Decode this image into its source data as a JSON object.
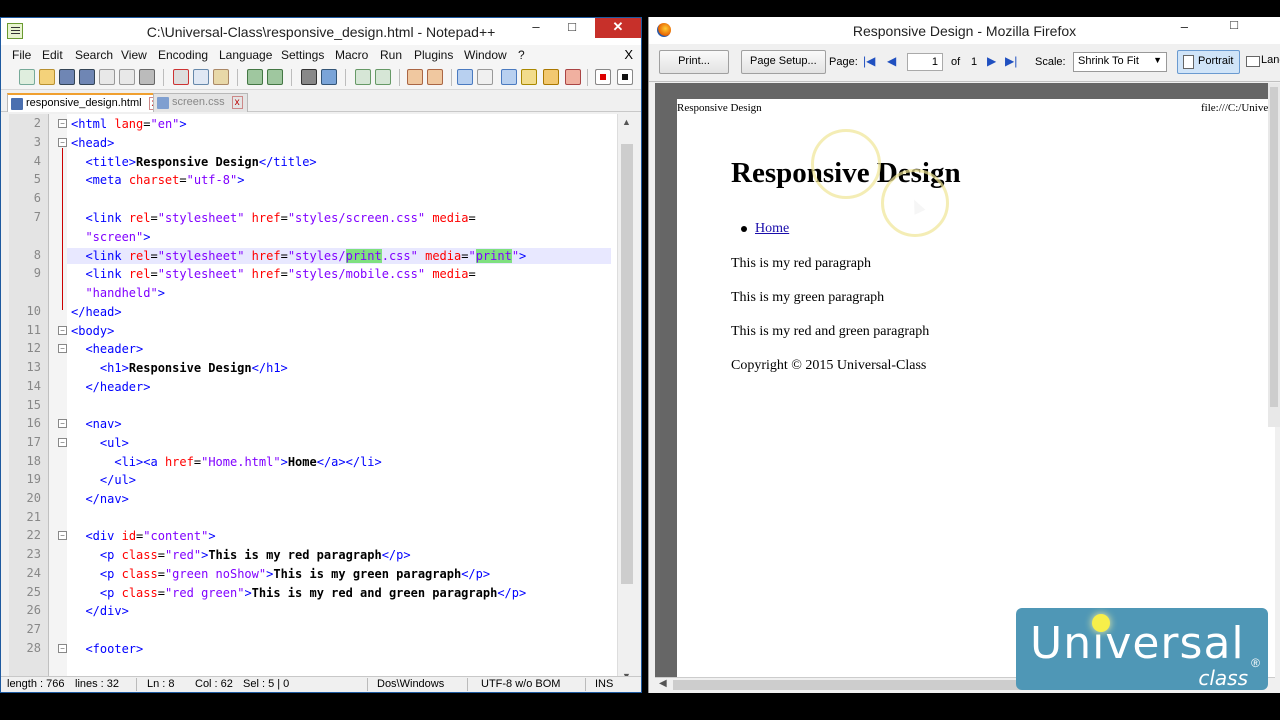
{
  "npp": {
    "title": "C:\\Universal-Class\\responsive_design.html - Notepad++",
    "window_min": "–",
    "window_max": "□",
    "window_close": "✕",
    "menu": [
      "File",
      "Edit",
      "Search",
      "View",
      "Encoding",
      "Language",
      "Settings",
      "Macro",
      "Run",
      "Plugins",
      "Window",
      "?"
    ],
    "menu_close": "X",
    "tabs": [
      {
        "label": "responsive_design.html",
        "active": true
      },
      {
        "label": "screen.css",
        "active": false
      }
    ],
    "tab_close": "x",
    "line_numbers": [
      "2",
      "3",
      "4",
      "5",
      "6",
      "7",
      "",
      "8",
      "9",
      "",
      "10",
      "11",
      "12",
      "13",
      "14",
      "15",
      "16",
      "17",
      "18",
      "19",
      "20",
      "21",
      "22",
      "23",
      "24",
      "25",
      "26",
      "27",
      "28"
    ],
    "status": {
      "length": "length : 766",
      "lines": "lines : 32",
      "ln": "Ln : 8",
      "col": "Col : 62",
      "sel": "Sel : 5 | 0",
      "eol": "Dos\\Windows",
      "encoding": "UTF-8 w/o BOM",
      "mode": "INS"
    }
  },
  "firefox": {
    "title": "Responsive Design - Mozilla Firefox",
    "window_min": "–",
    "window_max": "□",
    "print_button": "Print...",
    "page_setup_button": "Page Setup...",
    "page_label": "Page:",
    "page_value": "1",
    "of_label": "of",
    "total_pages": "1",
    "scale_label": "Scale:",
    "scale_value": "Shrink To Fit",
    "portrait_label": "Portrait",
    "landscape_label": "Landscape",
    "preview": {
      "header_left": "Responsive Design",
      "header_right": "file:///C:/Universal",
      "h1": "Responsive Design",
      "nav_link": "Home",
      "paragraphs": [
        "This is my red paragraph",
        "This is my green paragraph",
        "This is my red and green paragraph",
        "Copyright © 2015 Universal-Class"
      ]
    }
  },
  "logo": {
    "word": "Universal",
    "sub": "class",
    "reg": "®",
    "color": "#4f97b6"
  }
}
